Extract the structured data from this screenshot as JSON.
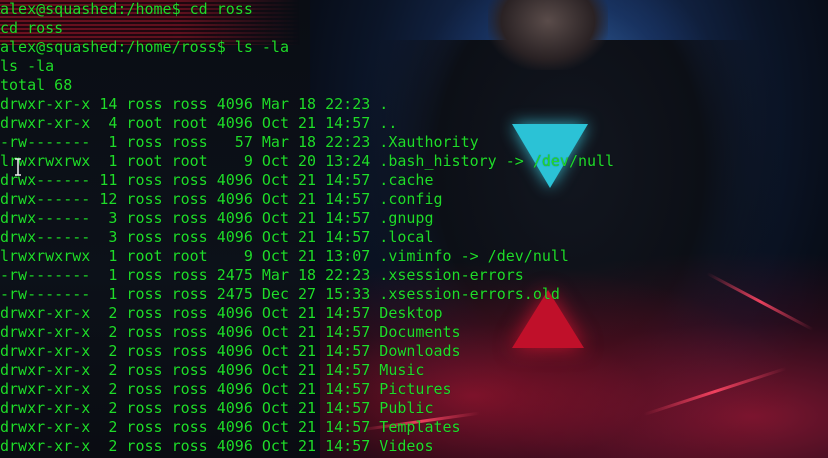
{
  "terminal": {
    "lines": [
      "alex@squashed:/home$ cd ross",
      "cd ross",
      "alex@squashed:/home/ross$ ls -la",
      "ls -la",
      "total 68",
      "drwxr-xr-x 14 ross ross 4096 Mar 18 22:23 .",
      "drwxr-xr-x  4 root root 4096 Oct 21 14:57 ..",
      "-rw-------  1 ross ross   57 Mar 18 22:23 .Xauthority",
      "lrwxrwxrwx  1 root root    9 Oct 20 13:24 .bash_history -> /dev/null",
      "drwx------ 11 ross ross 4096 Oct 21 14:57 .cache",
      "drwx------ 12 ross ross 4096 Oct 21 14:57 .config",
      "drwx------  3 ross ross 4096 Oct 21 14:57 .gnupg",
      "drwx------  3 ross ross 4096 Oct 21 14:57 .local",
      "lrwxrwxrwx  1 root root    9 Oct 21 13:07 .viminfo -> /dev/null",
      "-rw-------  1 ross ross 2475 Mar 18 22:23 .xsession-errors",
      "-rw-------  1 ross ross 2475 Dec 27 15:33 .xsession-errors.old",
      "drwxr-xr-x  2 ross ross 4096 Oct 21 14:57 Desktop",
      "drwxr-xr-x  2 ross ross 4096 Oct 21 14:57 Documents",
      "drwxr-xr-x  2 ross ross 4096 Oct 21 14:57 Downloads",
      "drwxr-xr-x  2 ross ross 4096 Oct 21 14:57 Music",
      "drwxr-xr-x  2 ross ross 4096 Oct 21 14:57 Pictures",
      "drwxr-xr-x  2 ross ross 4096 Oct 21 14:57 Public",
      "drwxr-xr-x  2 ross ross 4096 Oct 21 14:57 Templates",
      "drwxr-xr-x  2 ross ross 4096 Oct 21 14:57 Videos"
    ],
    "text_color": "#1fdc2a",
    "cursor_icon": "text-cursor-icon"
  },
  "wallpaper": {
    "description_icon": "wallpaper-image",
    "accent_cyan": "#2bc2d6",
    "accent_red": "#c0102a"
  }
}
